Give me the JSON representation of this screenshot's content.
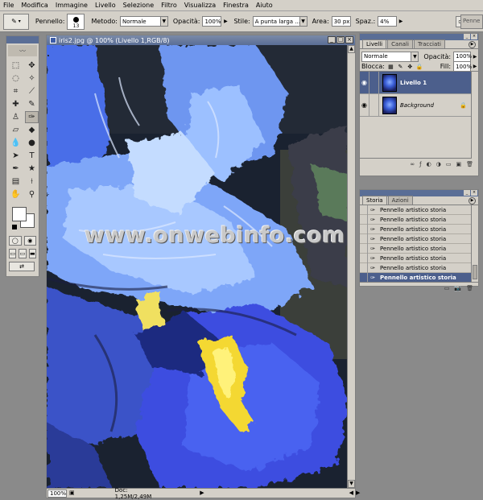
{
  "menu": [
    "File",
    "Modifica",
    "Immagine",
    "Livello",
    "Selezione",
    "Filtro",
    "Visualizza",
    "Finestra",
    "Aiuto"
  ],
  "options": {
    "brush_label": "Pennello:",
    "brush_size": "13",
    "mode_label": "Metodo:",
    "mode_value": "Normale",
    "opacity_label": "Opacità:",
    "opacity_value": "100%",
    "style_label": "Stile:",
    "style_value": "A punta larga ...",
    "area_label": "Area:",
    "area_value": "30 px",
    "spacing_label": "Spaz.:",
    "spacing_value": "4%",
    "brushes_tab": "Penne"
  },
  "document": {
    "title": "iris2.jpg @ 100% (Livello 1,RGB/8)",
    "zoom": "100%",
    "doc_info": "Doc: 1,25M/2,49M"
  },
  "watermark": "www.onwebinfo.com",
  "layers_panel": {
    "tabs": [
      "Livelli",
      "Canali",
      "Tracciati"
    ],
    "blend_mode": "Normale",
    "opacity_label": "Opacità:",
    "opacity_value": "100%",
    "lock_label": "Blocca:",
    "fill_label": "Fill:",
    "fill_value": "100%",
    "layers": [
      {
        "name": "Livello 1",
        "active": true
      },
      {
        "name": "Background",
        "active": false
      }
    ]
  },
  "history_panel": {
    "tabs": [
      "Storia",
      "Azioni"
    ],
    "items": [
      "Pennello artistico storia",
      "Pennello artistico storia",
      "Pennello artistico storia",
      "Pennello artistico storia",
      "Pennello artistico storia",
      "Pennello artistico storia",
      "Pennello artistico storia",
      "Pennello artistico storia"
    ]
  }
}
